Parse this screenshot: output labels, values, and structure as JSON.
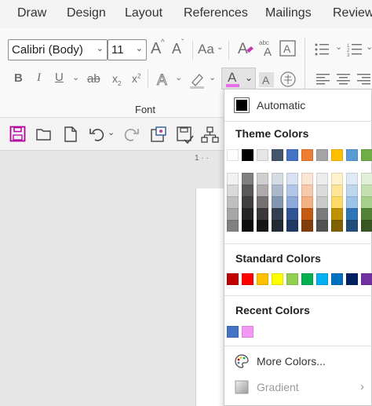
{
  "tabs": [
    "Draw",
    "Design",
    "Layout",
    "References",
    "Mailings",
    "Review"
  ],
  "font": {
    "name": "Calibri (Body)",
    "size": "11",
    "group_label": "Font"
  },
  "ribbon_glyphs": {
    "grow": "A",
    "shrink": "A",
    "change_case": "Aa",
    "bold": "B",
    "italic": "I",
    "underline": "U",
    "strike": "ab",
    "subscript": "x",
    "superscript": "x",
    "font_color": "A",
    "char_shading": "A"
  },
  "ruler_text": "1 · ·",
  "color_menu": {
    "automatic_label": "Automatic",
    "theme_title": "Theme Colors",
    "standard_title": "Standard Colors",
    "recent_title": "Recent Colors",
    "more_label": "More Colors...",
    "gradient_label": "Gradient",
    "theme_colors": [
      "#ffffff",
      "#000000",
      "#e7e6e6",
      "#44546a",
      "#4472c4",
      "#ed7d31",
      "#a5a5a5",
      "#ffc000",
      "#5b9bd5",
      "#70ad47"
    ],
    "theme_shades": [
      [
        "#f2f2f2",
        "#d9d9d9",
        "#bfbfbf",
        "#a6a6a6",
        "#808080"
      ],
      [
        "#808080",
        "#595959",
        "#404040",
        "#262626",
        "#0d0d0d"
      ],
      [
        "#d0cece",
        "#aeaaaa",
        "#757171",
        "#3b3838",
        "#161616"
      ],
      [
        "#d6dce4",
        "#acb9ca",
        "#8497b0",
        "#333f4f",
        "#222a35"
      ],
      [
        "#d9e2f3",
        "#b4c6e7",
        "#8eaadb",
        "#2f5496",
        "#1f3864"
      ],
      [
        "#fbe5d5",
        "#f7caac",
        "#f4b183",
        "#c55a11",
        "#833c0b"
      ],
      [
        "#ededed",
        "#dbdbdb",
        "#c9c9c9",
        "#7b7b7b",
        "#525252"
      ],
      [
        "#fff2cc",
        "#ffe599",
        "#ffd966",
        "#bf9000",
        "#7f6000"
      ],
      [
        "#deebf6",
        "#bdd7ee",
        "#9dc3e6",
        "#2e75b5",
        "#1e4e79"
      ],
      [
        "#e2efd9",
        "#c5e0b3",
        "#a8d08d",
        "#538135",
        "#375623"
      ]
    ],
    "standard_colors": [
      "#c00000",
      "#ff0000",
      "#ffc000",
      "#ffff00",
      "#92d050",
      "#00b050",
      "#00b0f0",
      "#0070c0",
      "#002060",
      "#7030a0"
    ],
    "recent_colors": [
      "#4472c4",
      "#f598f5"
    ]
  },
  "colors": {
    "accent": "#2b579a",
    "underline_pink": "#e86fe8",
    "save_purple": "#b4009e"
  }
}
